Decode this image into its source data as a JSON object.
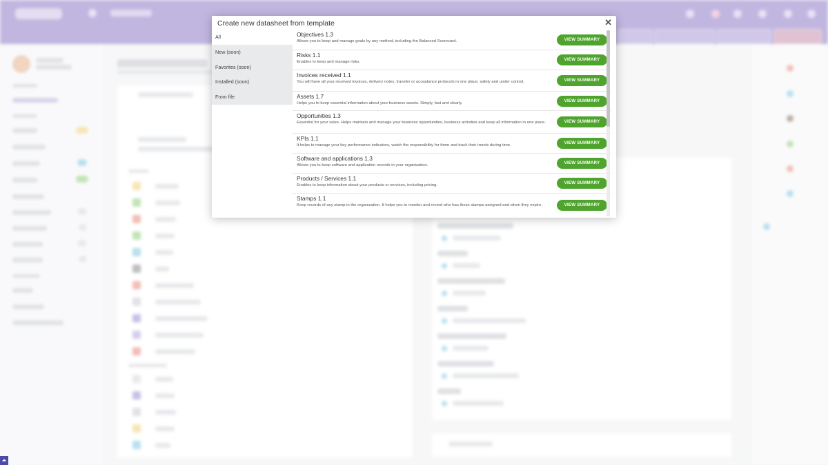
{
  "modal": {
    "title": "Create new datasheet from template",
    "close_icon": "close-icon",
    "tabs": [
      {
        "label": "All",
        "active": true
      },
      {
        "label": "New (soon)",
        "active": false
      },
      {
        "label": "Favorites (soon)",
        "active": false
      },
      {
        "label": "Installed (soon)",
        "active": false
      },
      {
        "label": "From file",
        "active": false
      }
    ],
    "button_label": "VIEW SUMMARY",
    "templates": [
      {
        "title": "Objectives 1.3",
        "desc": "Allows you to keep and manage goals by any method, including the Balanced Scorecard."
      },
      {
        "title": "Risks 1.1",
        "desc": "Enables to keep and manage risks."
      },
      {
        "title": "Invoices received 1.1",
        "desc": "You will have all your received invoices, delivery notes, transfer or acceptance protocols in one place, safely and under control."
      },
      {
        "title": "Assets 1.7",
        "desc": "Helps you to keep essential information about your business assets. Simply, fast and clearly."
      },
      {
        "title": "Opportunities 1.3",
        "desc": "Essential for your sales. Helps maintain and manage your business opportunities, business activities and keep all information in one place."
      },
      {
        "title": "KPIs 1.1",
        "desc": "It helps to manage your key performance indicators, watch the responsibility for them and track their trends during time."
      },
      {
        "title": "Software and applications 1.3",
        "desc": "Allows you to keep software and application records in your organization."
      },
      {
        "title": "Products / Services 1.1",
        "desc": "Enables to keep information about your products or services, including pricing."
      },
      {
        "title": "Stamps 1.1",
        "desc": "Keep records of any stamp in the organization. It helps you to monitor and record who has these stamps assigned and when they expire."
      }
    ]
  },
  "colors": {
    "topbar": "#8f7bc7",
    "button_green": "#4ea42d",
    "tab_inactive": "#e9eaec"
  }
}
